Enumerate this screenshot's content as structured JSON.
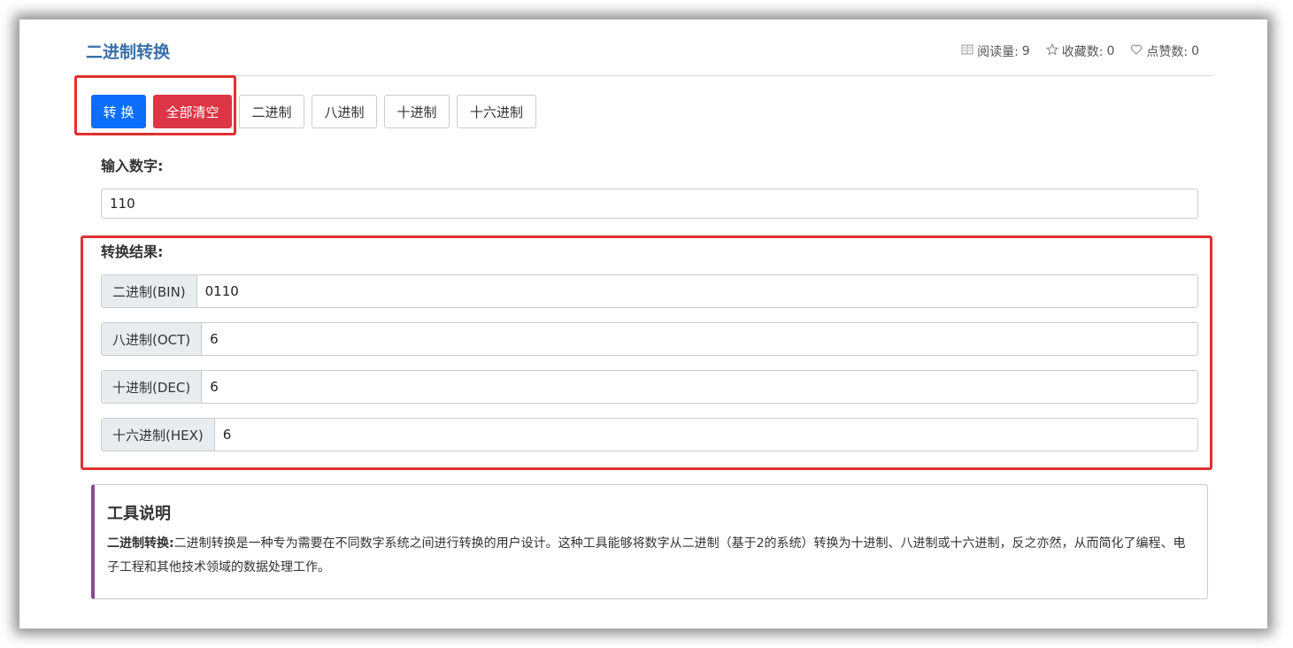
{
  "page": {
    "title": "二进制转换",
    "stats": [
      {
        "icon": "book-icon",
        "label": "阅读量:",
        "value": "9"
      },
      {
        "icon": "star-icon",
        "label": "收藏数:",
        "value": "0"
      },
      {
        "icon": "heart-icon",
        "label": "点赞数:",
        "value": "0"
      }
    ]
  },
  "toolbar": {
    "convert_label": "转 换",
    "clear_label": "全部清空",
    "bin_label": "二进制",
    "oct_label": "八进制",
    "dec_label": "十进制",
    "hex_label": "十六进制"
  },
  "input": {
    "label": "输入数字:",
    "value": "110"
  },
  "results": {
    "label": "转换结果:",
    "rows": [
      {
        "name": "二进制(BIN)",
        "value": "0110"
      },
      {
        "name": "八进制(OCT)",
        "value": "6"
      },
      {
        "name": "十进制(DEC)",
        "value": "6"
      },
      {
        "name": "十六进制(HEX)",
        "value": "6"
      }
    ]
  },
  "info": {
    "heading": "工具说明",
    "lead": "二进制转换:",
    "text": "二进制转换是一种专为需要在不同数字系统之间进行转换的用户设计。这种工具能够将数字从二进制（基于2的系统）转换为十进制、八进制或十六进制，反之亦然，从而简化了编程、电子工程和其他技术领域的数据处理工作。"
  },
  "colors": {
    "primary": "#0d6efd",
    "danger": "#dc3545",
    "title": "#3a6fa8",
    "highlight": "#e03030",
    "accent_bar": "#8a4a8f"
  }
}
